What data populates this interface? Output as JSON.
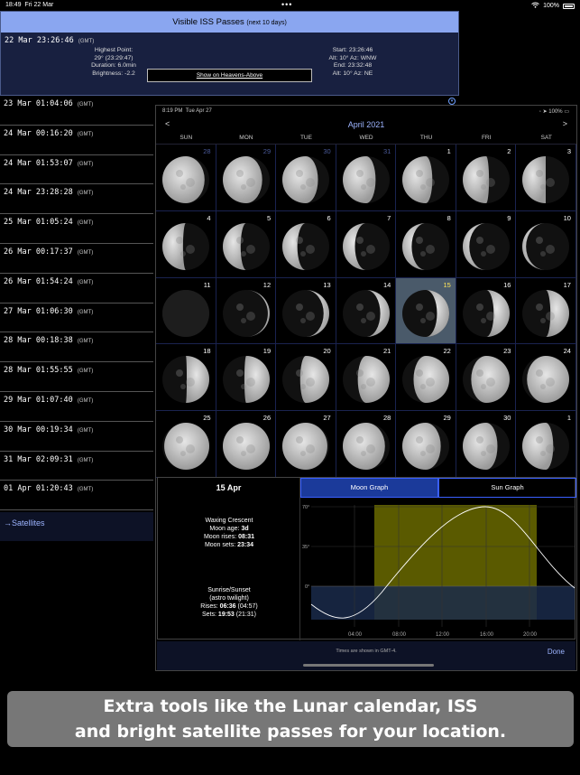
{
  "status_bar": {
    "time": "18:49",
    "date": "Fri 22 Mar",
    "battery": "100%"
  },
  "iss": {
    "title": "Visible ISS Passes",
    "subtitle": "(next 10 days)",
    "first_pass": {
      "datetime": "22 Mar 23:26:46",
      "tz": "(GMT)",
      "highest_label": "Highest Point:",
      "highest_value": "29° (23:29:47)",
      "duration": "Duration: 6.0min",
      "brightness": "Brightness: -2.2",
      "start": "Start: 23:26:46",
      "start_alt": "Alt: 10° Az: WNW",
      "end": "End: 23:32:48",
      "end_alt": "Alt: 10° Az: NE"
    },
    "heavens_button": "Show on Heavens-Above",
    "passes": [
      "23 Mar 01:04:06",
      "24 Mar 00:16:20",
      "24 Mar 01:53:07",
      "24 Mar 23:28:28",
      "25 Mar 01:05:24",
      "26 Mar 00:17:37",
      "26 Mar 01:54:24",
      "27 Mar 01:06:30",
      "28 Mar 00:18:38",
      "28 Mar 01:55:55",
      "29 Mar 01:07:40",
      "30 Mar 00:19:34",
      "31 Mar 02:09:31",
      "01 Apr 01:20:43"
    ],
    "pass_tz": "(GMT)",
    "satellites_link": "→Satellites"
  },
  "lunar": {
    "status": {
      "time": "8:19 PM",
      "date": "Tue Apr 27",
      "battery": "100%"
    },
    "month": "April 2021",
    "prev": "<",
    "next": ">",
    "weekdays": [
      "SUN",
      "MON",
      "TUE",
      "WED",
      "THU",
      "FRI",
      "SAT"
    ],
    "days": [
      {
        "n": "28",
        "p": 0.55,
        "dim": true
      },
      {
        "n": "29",
        "p": 0.58,
        "dim": true
      },
      {
        "n": "30",
        "p": 0.62,
        "dim": true
      },
      {
        "n": "31",
        "p": 0.65,
        "dim": true
      },
      {
        "n": "1",
        "p": 0.68
      },
      {
        "n": "2",
        "p": 0.72
      },
      {
        "n": "3",
        "p": 0.75
      },
      {
        "n": "4",
        "p": 0.78
      },
      {
        "n": "5",
        "p": 0.81
      },
      {
        "n": "6",
        "p": 0.84
      },
      {
        "n": "7",
        "p": 0.87
      },
      {
        "n": "8",
        "p": 0.9
      },
      {
        "n": "9",
        "p": 0.93
      },
      {
        "n": "10",
        "p": 0.96
      },
      {
        "n": "11",
        "p": 0.0
      },
      {
        "n": "12",
        "p": 0.02
      },
      {
        "n": "13",
        "p": 0.06
      },
      {
        "n": "14",
        "p": 0.1
      },
      {
        "n": "15",
        "p": 0.13,
        "sel": true
      },
      {
        "n": "16",
        "p": 0.17
      },
      {
        "n": "17",
        "p": 0.2
      },
      {
        "n": "18",
        "p": 0.24
      },
      {
        "n": "19",
        "p": 0.27
      },
      {
        "n": "20",
        "p": 0.31
      },
      {
        "n": "21",
        "p": 0.34
      },
      {
        "n": "22",
        "p": 0.38
      },
      {
        "n": "23",
        "p": 0.41
      },
      {
        "n": "24",
        "p": 0.45
      },
      {
        "n": "25",
        "p": 0.48
      },
      {
        "n": "26",
        "p": 0.5
      },
      {
        "n": "27",
        "p": 0.52
      },
      {
        "n": "28",
        "p": 0.55
      },
      {
        "n": "29",
        "p": 0.59
      },
      {
        "n": "30",
        "p": 0.63
      },
      {
        "n": "1",
        "p": 0.67
      }
    ],
    "selected_date": "15 Apr",
    "phase_name": "Waxing Crescent",
    "moon_age_label": "Moon age:",
    "moon_age": "3d",
    "moon_rises_label": "Moon rises:",
    "moon_rises": "08:31",
    "moon_sets_label": "Moon sets:",
    "moon_sets": "23:34",
    "sun_title": "Sunrise/Sunset",
    "sun_sub": "(astro twilight)",
    "sun_rises_label": "Rises:",
    "sun_rises": "06:36",
    "sun_rises_astro": "(04:57)",
    "sun_sets_label": "Sets:",
    "sun_sets": "19:53",
    "sun_sets_astro": "(21:31)",
    "tab_moon": "Moon Graph",
    "tab_sun": "Sun Graph",
    "graph": {
      "y_labels": [
        "70°",
        "35°",
        "0°"
      ],
      "x_labels": [
        "04:00",
        "08:00",
        "12:00",
        "16:00",
        "20:00"
      ]
    },
    "footer_note": "Times are shown in GMT-4.",
    "done": "Done"
  },
  "caption": {
    "line1": "Extra tools like the Lunar calendar, ISS",
    "line2": "and bright satellite passes for your location."
  }
}
